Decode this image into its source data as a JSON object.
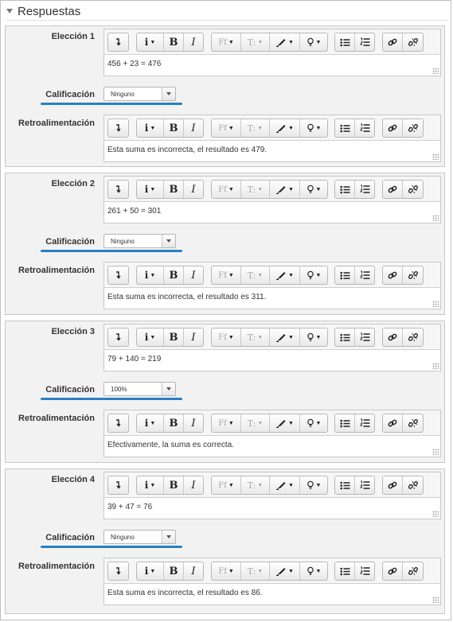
{
  "section": {
    "title": "Respuestas"
  },
  "labels": {
    "grade": "Calificación",
    "feedback": "Retroalimentación"
  },
  "toolbar": {
    "icons": [
      "collapse-icon",
      "info-icon",
      "bold-icon",
      "italic-icon",
      "font-family-icon",
      "text-size-icon",
      "text-color-icon",
      "highlight-icon",
      "bullet-list-icon",
      "numbered-list-icon",
      "link-icon",
      "unlink-icon"
    ],
    "bold": "B",
    "italic": "I",
    "font": "Ff",
    "size": "T:"
  },
  "choices": [
    {
      "label": "Elección 1",
      "answer": "456 + 23 = 476",
      "grade": "Ninguno",
      "feedback": "Esta suma es incorrecta, el resultado es 479."
    },
    {
      "label": "Elección 2",
      "answer": "261 + 50 = 301",
      "grade": "Ninguno",
      "feedback": "Esta suma es incorrecta, el resultado es 311."
    },
    {
      "label": "Elección 3",
      "answer": "79 + 140 = 219",
      "grade": "100%",
      "feedback": "Efectivamente, la suma es correcta."
    },
    {
      "label": "Elección 4",
      "answer": "39 + 47 = 76",
      "grade": "Ninguno",
      "feedback": "Esta suma es incorrecta, el resultado es 86."
    }
  ],
  "colors": {
    "accent_underline": "#2a7fc1",
    "panel_bg": "#f2f2f2"
  }
}
